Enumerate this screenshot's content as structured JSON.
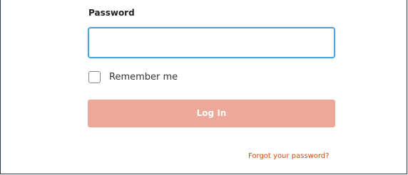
{
  "form": {
    "password_label": "Password",
    "password_value": "",
    "remember_label": "Remember me",
    "remember_checked": false,
    "login_label": "Log In",
    "forgot_label": "Forgot your password?"
  },
  "colors": {
    "input_focus_border": "#4aa3d9",
    "button_background": "#eca898",
    "link": "#d9480f"
  }
}
